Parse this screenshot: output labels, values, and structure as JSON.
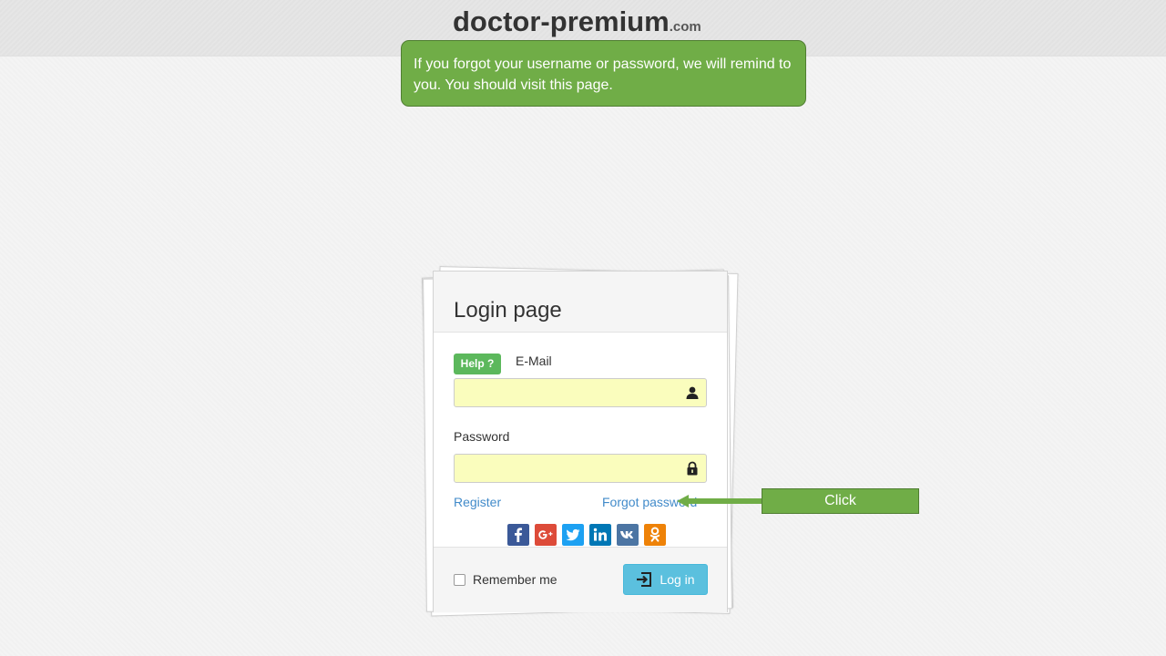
{
  "header": {
    "logo_main": "doctor-premium",
    "logo_tld": ".com"
  },
  "callout": {
    "text": "If you forgot your username or password, we will remind to you. You should visit this page."
  },
  "login_card": {
    "title": "Login page",
    "help_label": "Help ?",
    "email_label": "E-Mail",
    "email_value": "",
    "password_label": "Password",
    "password_value": "",
    "register_link": "Register",
    "forgot_link": "Forgot password",
    "remember_label": "Remember me",
    "remember_checked": false,
    "login_button": "Log in",
    "social_icons": [
      {
        "name": "facebook-icon",
        "color": "#3b5998"
      },
      {
        "name": "google-plus-icon",
        "color": "#dd4b39"
      },
      {
        "name": "twitter-icon",
        "color": "#1da1f2"
      },
      {
        "name": "linkedin-icon",
        "color": "#0077b5"
      },
      {
        "name": "vk-icon",
        "color": "#4c75a3"
      },
      {
        "name": "odnoklassniki-icon",
        "color": "#ee8208"
      }
    ]
  },
  "annotation": {
    "click_label": "Click"
  },
  "colors": {
    "callout_bg": "#70ad47",
    "help_badge": "#5cb85c",
    "login_button": "#5bc0de",
    "input_bg": "#fafdbd",
    "link": "#428bca"
  }
}
